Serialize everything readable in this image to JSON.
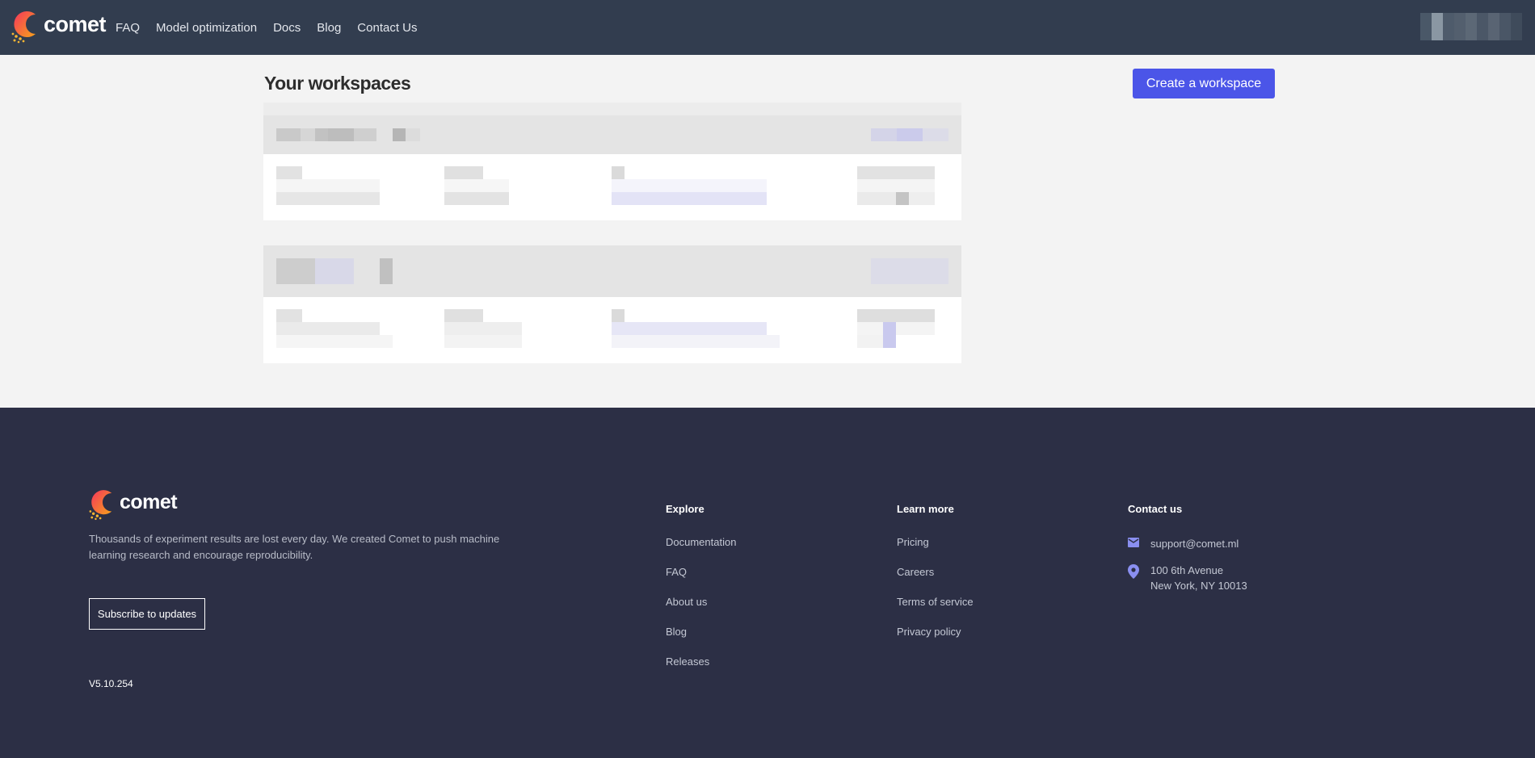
{
  "brand": {
    "name": "comet"
  },
  "nav": {
    "links": [
      "FAQ",
      "Model optimization",
      "Docs",
      "Blog",
      "Contact Us"
    ]
  },
  "main": {
    "title": "Your workspaces",
    "create_label": "Create a workspace"
  },
  "footer": {
    "tagline": "Thousands of experiment results are lost every day. We created Comet to push machine learning research and encourage reproducibility.",
    "subscribe_label": "Subscribe to updates",
    "version": "V5.10.254",
    "explore": {
      "heading": "Explore",
      "links": [
        "Documentation",
        "FAQ",
        "About us",
        "Blog",
        "Releases"
      ]
    },
    "learn_more": {
      "heading": "Learn more",
      "links": [
        "Pricing",
        "Careers",
        "Terms of service",
        "Privacy policy"
      ]
    },
    "contact": {
      "heading": "Contact us",
      "email": "support@comet.ml",
      "address_line1": "100 6th Avenue",
      "address_line2": "New York, NY 10013"
    }
  },
  "colors": {
    "nav_bg": "#323d4f",
    "footer_bg": "#2c2f45",
    "accent": "#4b55e8",
    "icon_accent": "#8a8ff0"
  },
  "icons": {
    "logo": "comet-logo-icon",
    "email": "mail-icon",
    "location": "map-pin-icon"
  }
}
